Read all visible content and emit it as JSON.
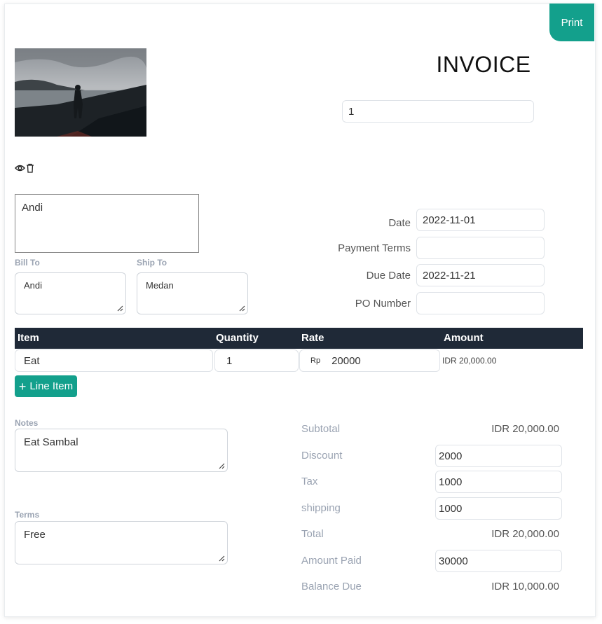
{
  "toolbar": {
    "print_label": "Print"
  },
  "invoice": {
    "title": "INVOICE",
    "number": "1"
  },
  "logo": {
    "icon_view": "eye-icon",
    "icon_delete": "trash-icon"
  },
  "from": {
    "name": "Andi"
  },
  "bill_to": {
    "label": "Bill To",
    "value": "Andi"
  },
  "ship_to": {
    "label": "Ship To",
    "value": "Medan"
  },
  "meta": {
    "date_label": "Date",
    "date_value": "2022-11-01",
    "terms_label": "Payment Terms",
    "terms_value": "",
    "due_label": "Due Date",
    "due_value": "2022-11-21",
    "po_label": "PO Number",
    "po_value": ""
  },
  "table": {
    "headers": [
      "Item",
      "Quantity",
      "Rate",
      "Amount"
    ],
    "rows": [
      {
        "item": "Eat",
        "quantity": "1",
        "currency": "Rp",
        "rate": "20000",
        "amount": "IDR 20,000.00"
      }
    ],
    "add_label": "Line Item"
  },
  "notes": {
    "label": "Notes",
    "value": "Eat Sambal"
  },
  "terms": {
    "label": "Terms",
    "value": "Free"
  },
  "totals": {
    "subtotal_label": "Subtotal",
    "subtotal_value": "IDR 20,000.00",
    "discount_label": "Discount",
    "discount_value": "2000",
    "tax_label": "Tax",
    "tax_value": "1000",
    "shipping_label": "shipping",
    "shipping_value": "1000",
    "total_label": "Total",
    "total_value": "IDR 20,000.00",
    "paid_label": "Amount Paid",
    "paid_value": "30000",
    "balance_label": "Balance Due",
    "balance_value": "IDR 10,000.00"
  },
  "colors": {
    "accent": "#13a08c",
    "header_bg": "#1f2937",
    "muted": "#9aa3b2"
  }
}
